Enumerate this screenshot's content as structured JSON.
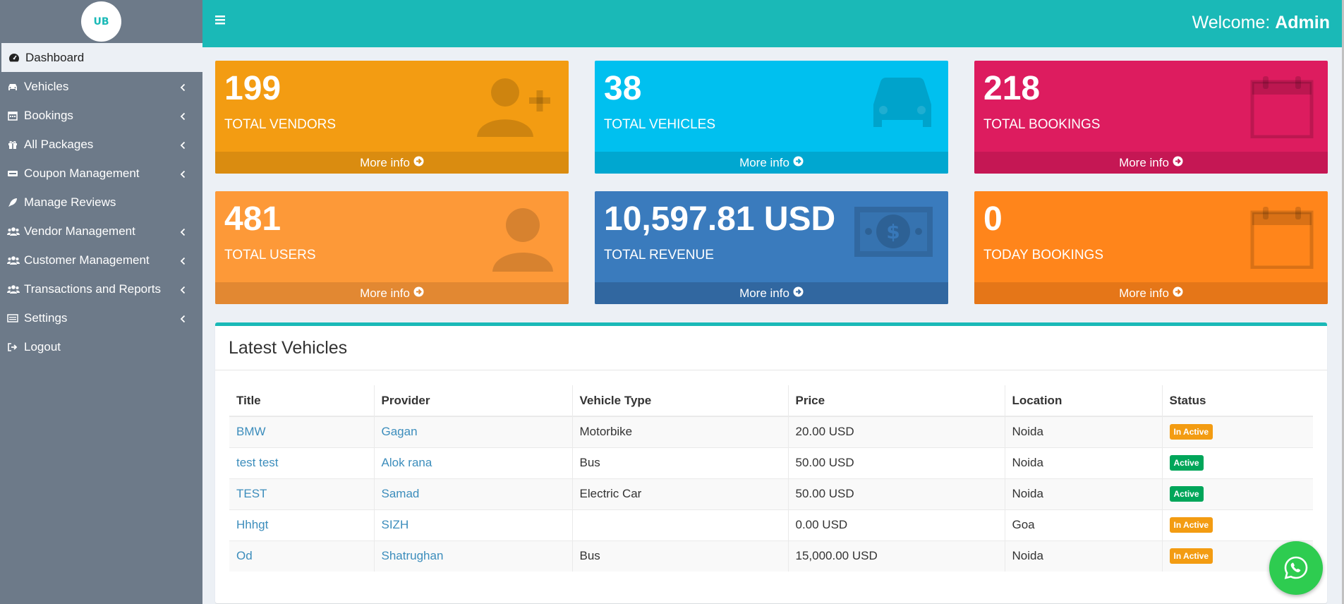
{
  "brand": {
    "logo_text": "UB"
  },
  "sidebar": {
    "items": [
      {
        "label": "Dashboard",
        "icon": "dashboard-icon",
        "has_arrow": false
      },
      {
        "label": "Vehicles",
        "icon": "car-icon",
        "has_arrow": true
      },
      {
        "label": "Bookings",
        "icon": "calendar-icon",
        "has_arrow": true
      },
      {
        "label": "All Packages",
        "icon": "gift-icon",
        "has_arrow": true
      },
      {
        "label": "Coupon Management",
        "icon": "coupon-icon",
        "has_arrow": true
      },
      {
        "label": "Manage Reviews",
        "icon": "rocket-icon",
        "has_arrow": false
      },
      {
        "label": "Vendor Management",
        "icon": "users-icon",
        "has_arrow": true
      },
      {
        "label": "Customer Management",
        "icon": "users-icon",
        "has_arrow": true
      },
      {
        "label": "Transactions and Reports",
        "icon": "users-icon",
        "has_arrow": true
      },
      {
        "label": "Settings",
        "icon": "list-icon",
        "has_arrow": true
      },
      {
        "label": "Logout",
        "icon": "logout-icon",
        "has_arrow": false
      }
    ]
  },
  "header": {
    "welcome_prefix": "Welcome:",
    "user": "Admin"
  },
  "stats": [
    {
      "value": "199",
      "label": "TOTAL VENDORS",
      "more": "More info",
      "color": "#f39c12",
      "foot_color": "#da8c10",
      "icon": "user-plus-icon"
    },
    {
      "value": "38",
      "label": "TOTAL VEHICLES",
      "more": "More info",
      "color": "#00c0ef",
      "foot_color": "#00a7d0",
      "icon": "car-icon"
    },
    {
      "value": "218",
      "label": "TOTAL BOOKINGS",
      "more": "More info",
      "color": "#dd1c5f",
      "foot_color": "#c51754",
      "icon": "calendar-icon"
    },
    {
      "value": "481",
      "label": "TOTAL USERS",
      "more": "More info",
      "color": "#fd9938",
      "foot_color": "#e28832",
      "icon": "user-icon"
    },
    {
      "value": "10,597.81 USD",
      "label": "TOTAL REVENUE",
      "more": "More info",
      "color": "#3a7bbd",
      "foot_color": "#3167a0",
      "icon": "money-icon"
    },
    {
      "value": "0",
      "label": "TODAY BOOKINGS",
      "more": "More info",
      "color": "#ff851b",
      "foot_color": "#e57618",
      "icon": "calendar-icon"
    }
  ],
  "latest": {
    "title": "Latest Vehicles",
    "columns": [
      "Title",
      "Provider",
      "Vehicle Type",
      "Price",
      "Location",
      "Status"
    ],
    "rows": [
      {
        "title": "BMW",
        "provider": "Gagan",
        "type": "Motorbike",
        "price": "20.00 USD",
        "location": "Noida",
        "status": "In Active",
        "status_kind": "inactive"
      },
      {
        "title": "test test",
        "provider": "Alok rana",
        "type": "Bus",
        "price": "50.00 USD",
        "location": "Noida",
        "status": "Active",
        "status_kind": "active"
      },
      {
        "title": "TEST",
        "provider": "Samad",
        "type": "Electric Car",
        "price": "50.00 USD",
        "location": "Noida",
        "status": "Active",
        "status_kind": "active"
      },
      {
        "title": "Hhhgt",
        "provider": "SIZH",
        "type": "",
        "price": "0.00 USD",
        "location": "Goa",
        "status": "In Active",
        "status_kind": "inactive"
      },
      {
        "title": "Od",
        "provider": "Shatrughan",
        "type": "Bus",
        "price": "15,000.00 USD",
        "location": "Noida",
        "status": "In Active",
        "status_kind": "inactive"
      }
    ]
  },
  "colors": {
    "teal": "#1ab9b7",
    "sidebar": "#6d7a89",
    "link": "#3c8dbc",
    "whatsapp": "#2ecc50"
  }
}
